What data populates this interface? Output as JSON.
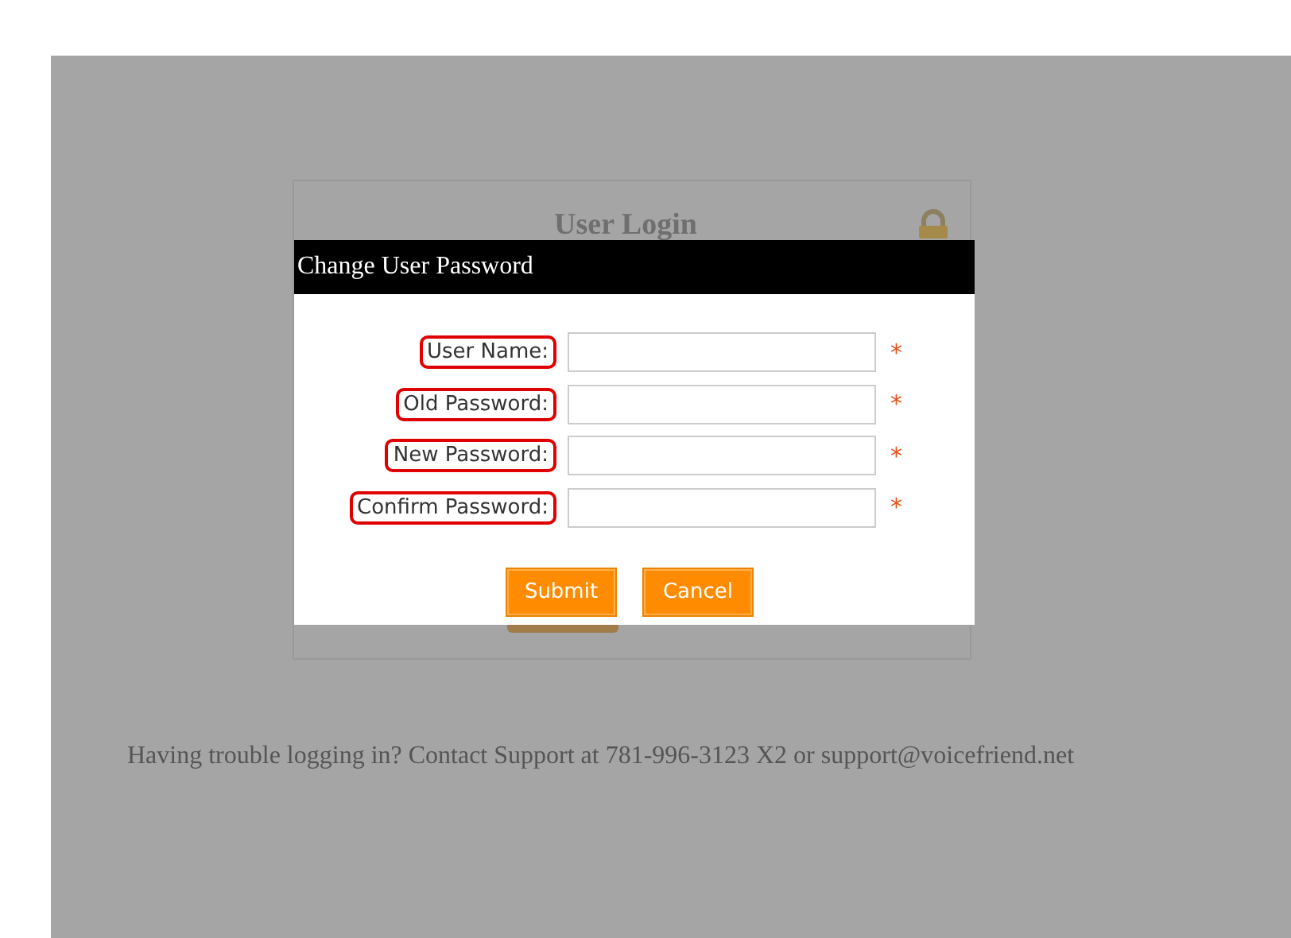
{
  "login_panel": {
    "title": "User Login"
  },
  "dialog": {
    "title": "Change User Password",
    "fields": [
      {
        "label": "User Name:",
        "required_mark": "*",
        "highlighted": true
      },
      {
        "label": "Old Password:",
        "required_mark": "*",
        "highlighted": true
      },
      {
        "label": "New Password:",
        "required_mark": "*",
        "highlighted": true
      },
      {
        "label": "Confirm Password:",
        "required_mark": "*",
        "highlighted": true
      }
    ],
    "buttons": [
      "Submit",
      "Cancel"
    ]
  },
  "footer": "Having trouble logging in? Contact Support at 781-996-3123 X2 or support@voicefriend.net"
}
